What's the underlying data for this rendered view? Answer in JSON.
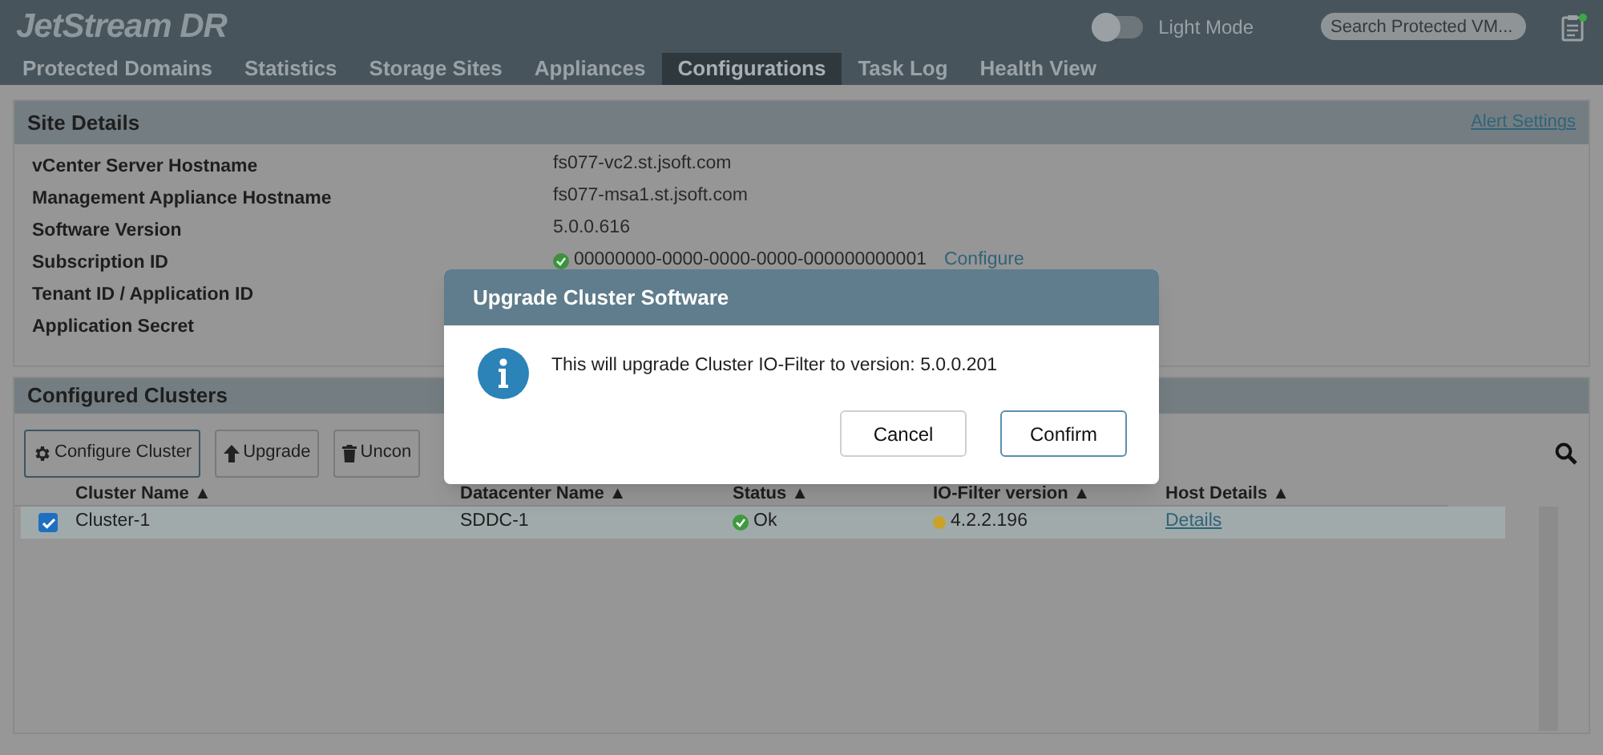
{
  "app": {
    "title": "JetStream DR"
  },
  "light_mode": {
    "label": "Light Mode",
    "on": false
  },
  "search": {
    "placeholder": "Search Protected VM..."
  },
  "tabs": [
    {
      "label": "Protected Domains",
      "selected": false
    },
    {
      "label": "Statistics",
      "selected": false
    },
    {
      "label": "Storage Sites",
      "selected": false
    },
    {
      "label": "Appliances",
      "selected": false
    },
    {
      "label": "Configurations",
      "selected": true
    },
    {
      "label": "Task Log",
      "selected": false
    },
    {
      "label": "Health View",
      "selected": false
    }
  ],
  "site_details": {
    "title": "Site Details",
    "link": "Alert Settings",
    "rows": [
      {
        "label": "vCenter Server Hostname",
        "value": "fs077-vc2.st.jsoft.com",
        "verified": false
      },
      {
        "label": "Management Appliance Hostname",
        "value": "fs077-msa1.st.jsoft.com",
        "verified": false
      },
      {
        "label": "Software Version",
        "value": "5.0.0.616",
        "verified": false
      },
      {
        "label": "Subscription ID",
        "value": "00000000-0000-0000-0000-000000000001",
        "verified": true,
        "action": "Configure"
      },
      {
        "label": "Tenant ID / Application ID"
      },
      {
        "label": "Application Secret"
      }
    ]
  },
  "clusters": {
    "title": "Configured Clusters",
    "toolbar": [
      {
        "label": "Configure Cluster",
        "kind": "gear"
      },
      {
        "label": "Upgrade",
        "kind": "up"
      },
      {
        "label": "Uncon",
        "kind": "trash"
      }
    ],
    "columns": [
      "Cluster Name ▲",
      "Datacenter Name ▲",
      "Status ▲",
      "IO-Filter version ▲",
      "Host Details ▲"
    ],
    "rows": [
      {
        "checked": true,
        "selected": true,
        "cluster_name": "Cluster-1",
        "datacenter": "SDDC-1",
        "status": {
          "text": "Ok",
          "color": "#3e9a3e"
        },
        "version": {
          "text": "4.2.2.196",
          "color": "#c9a227"
        },
        "host_details": "Details"
      }
    ]
  },
  "dialog": {
    "title": "Upgrade Cluster Software",
    "message": "This will upgrade Cluster IO-Filter to version: 5.0.0.201",
    "buttons": [
      {
        "label": "Cancel",
        "primary": false
      },
      {
        "label": "Confirm",
        "primary": true
      }
    ]
  }
}
